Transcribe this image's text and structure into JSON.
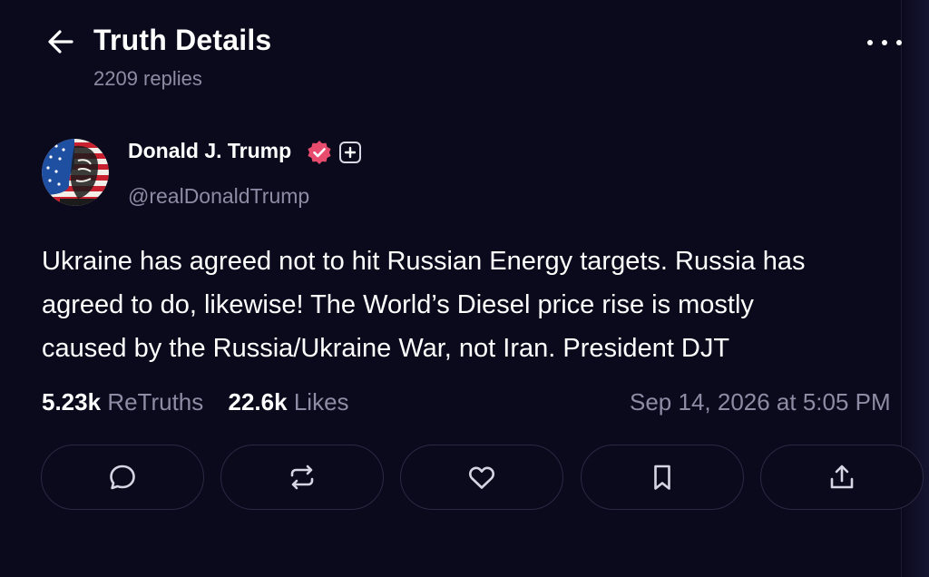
{
  "header": {
    "title": "Truth Details",
    "replies": "2209 replies",
    "back_icon": "arrow-left-icon",
    "more_icon": "more-horizontal-icon"
  },
  "author": {
    "name": "Donald J. Trump",
    "handle": "@realDonaldTrump",
    "verified_icon": "verified-badge-icon",
    "verified_color": "#e74c6f",
    "plus_icon": "plus-badge-icon",
    "avatar": "avatar-flag-portrait"
  },
  "post": {
    "text": "Ukraine has agreed not to hit Russian Energy targets. Russia has\nagreed to do, likewise! The World’s Diesel price rise is mostly\ncaused by the Russia/Ukraine War, not Iran. President DJT"
  },
  "stats": {
    "retruths_count": "5.23k",
    "retruths_label": "ReTruths",
    "likes_count": "22.6k",
    "likes_label": "Likes",
    "timestamp": "Sep 14, 2026 at 5:05 PM"
  },
  "actions": [
    {
      "name": "reply",
      "icon": "comment-icon"
    },
    {
      "name": "retruth",
      "icon": "repost-icon"
    },
    {
      "name": "like",
      "icon": "heart-icon"
    },
    {
      "name": "bookmark",
      "icon": "bookmark-icon"
    },
    {
      "name": "share",
      "icon": "share-icon"
    }
  ],
  "colors": {
    "background": "#0b0a1c",
    "text": "#ffffff",
    "muted": "#8d8ca4",
    "border": "#2a2944"
  }
}
